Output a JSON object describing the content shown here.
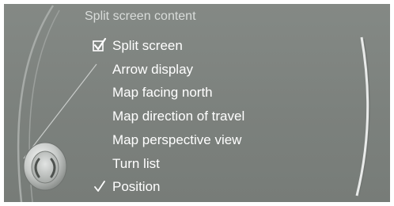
{
  "header": {
    "title": "Split screen content"
  },
  "menu": {
    "items": [
      {
        "label": "Split screen",
        "state": "selected-checked"
      },
      {
        "label": "Arrow display",
        "state": "normal"
      },
      {
        "label": "Map facing north",
        "state": "normal"
      },
      {
        "label": "Map direction of travel",
        "state": "normal"
      },
      {
        "label": "Map perspective view",
        "state": "normal"
      },
      {
        "label": "Turn list",
        "state": "normal"
      },
      {
        "label": "Position",
        "state": "checked"
      }
    ]
  },
  "colors": {
    "background": "#7f8480",
    "text": "#ffffff",
    "title_text": "#d9dcda",
    "selection_line": "#ffffff"
  },
  "icons": {
    "checkbox": "checkbox-checked-icon",
    "checkmark": "checkmark-icon",
    "controller": "controller-knob-icon",
    "scrollbar": "scrollbar-track"
  }
}
